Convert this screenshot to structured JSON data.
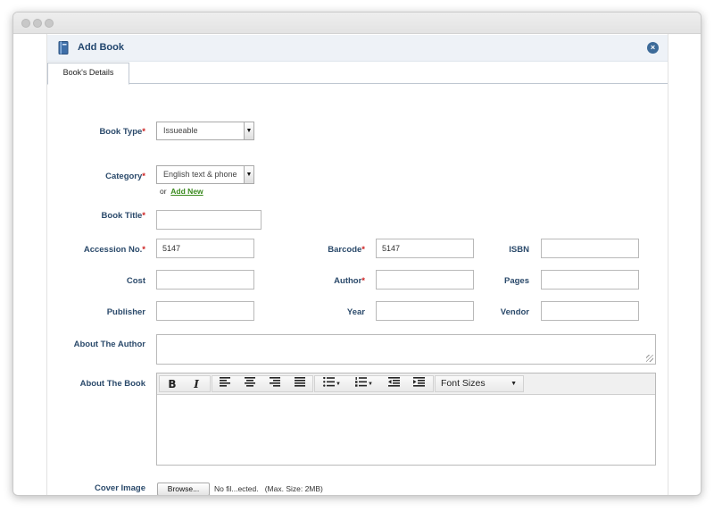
{
  "panel": {
    "title": "Add Book",
    "close_glyph": "×",
    "icon": "book-icon",
    "tab_label": "Book's Details"
  },
  "labels": {
    "book_type": "Book Type",
    "category": "Category",
    "book_title": "Book Title",
    "accession_no": "Accession No.",
    "barcode": "Barcode",
    "isbn": "ISBN",
    "cost": "Cost",
    "author": "Author",
    "pages": "Pages",
    "publisher": "Publisher",
    "year": "Year",
    "vendor": "Vendor",
    "about_author": "About The Author",
    "about_book": "About The Book",
    "cover_image": "Cover Image",
    "required_mark": "*"
  },
  "values": {
    "book_type": "Issueable",
    "category": "English text & phone",
    "book_title": "",
    "accession_no": "5147",
    "barcode": "5147",
    "isbn": "",
    "cost": "",
    "author": "",
    "pages": "",
    "publisher": "",
    "year": "",
    "vendor": ""
  },
  "category_links": {
    "or": "or",
    "add_new": "Add New"
  },
  "editor": {
    "font_sizes_label": "Font Sizes",
    "buttons": [
      "bold-icon",
      "italic-icon",
      "align-left-icon",
      "align-center-icon",
      "align-right-icon",
      "align-justify-icon",
      "bullet-list-icon",
      "numbered-list-icon",
      "outdent-icon",
      "indent-icon"
    ]
  },
  "cover": {
    "browse_label": "Browse...",
    "file_status": "No fil...ected.",
    "max_size": "(Max. Size: 2MB)"
  },
  "colors": {
    "label": "#2b4a6b",
    "required": "#cc1e1e",
    "link": "#3a8a1e",
    "header_bg": "#eef2f7",
    "close_button": "#3d6b99"
  }
}
